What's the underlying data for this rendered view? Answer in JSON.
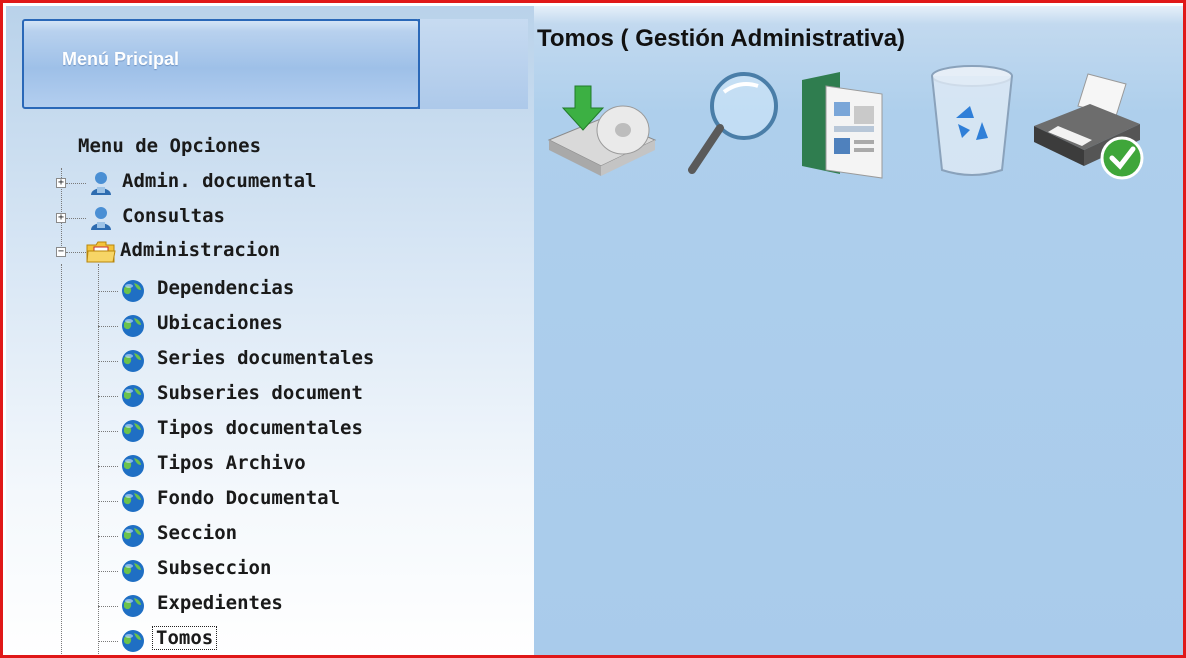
{
  "menu_header": {
    "label": "Menú Pricipal"
  },
  "tree": {
    "title": "Menu de Opciones",
    "nodes": [
      {
        "label": "Admin. documental",
        "expanded": false,
        "icon": "user-icon"
      },
      {
        "label": "Consultas",
        "expanded": false,
        "icon": "user-icon"
      },
      {
        "label": "Administracion",
        "expanded": true,
        "icon": "folder-icon"
      }
    ],
    "children": [
      {
        "label": "Dependencias",
        "icon": "globe-icon"
      },
      {
        "label": "Ubicaciones",
        "icon": "globe-icon"
      },
      {
        "label": "Series documentales",
        "icon": "globe-icon"
      },
      {
        "label": "Subseries document",
        "icon": "globe-icon"
      },
      {
        "label": "Tipos documentales",
        "icon": "globe-icon"
      },
      {
        "label": "Tipos Archivo",
        "icon": "globe-icon"
      },
      {
        "label": "Fondo Documental",
        "icon": "globe-icon"
      },
      {
        "label": "Seccion",
        "icon": "globe-icon"
      },
      {
        "label": "Subseccion",
        "icon": "globe-icon"
      },
      {
        "label": "Expedientes",
        "icon": "globe-icon"
      },
      {
        "label": "Tomos",
        "icon": "globe-icon",
        "selected": true
      }
    ]
  },
  "page": {
    "title": "Tomos ( Gestión Administrativa)"
  },
  "toolbar": {
    "buttons": [
      {
        "icon": "save-disk-icon"
      },
      {
        "icon": "search-icon"
      },
      {
        "icon": "report-icon"
      },
      {
        "icon": "recycle-bin-icon"
      },
      {
        "icon": "printer-icon"
      }
    ]
  }
}
